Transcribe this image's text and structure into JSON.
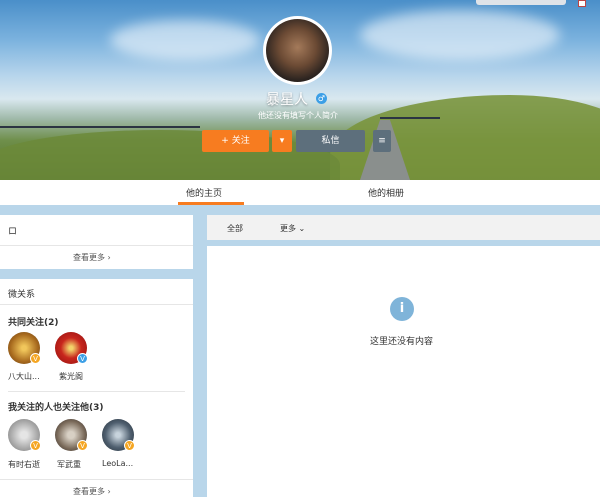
{
  "profile": {
    "name": "暴星人",
    "gender_icon": "male-icon",
    "bio": "他还没有填写个人简介"
  },
  "actions": {
    "follow_label": "+ 关注",
    "message_label": "私信"
  },
  "tabs": [
    {
      "label": "他的主页",
      "active": true
    },
    {
      "label": "他的相册",
      "active": false
    }
  ],
  "left": {
    "box1_title": "ロ",
    "box1_more": "查看更多 ›",
    "relations_title": "微关系",
    "mutual_title": "共同关注(2)",
    "mutual_users": [
      {
        "name": "八大山...",
        "badge": "V",
        "badge_color": "#f5a623"
      },
      {
        "name": "紫光阁",
        "badge": "V",
        "badge_color": "#3c9fe6"
      }
    ],
    "follow_title": "我关注的人也关注他(3)",
    "follow_users": [
      {
        "name": "有时右逝",
        "badge": "V",
        "badge_color": "#f5a623"
      },
      {
        "name": "军武重",
        "badge": "V",
        "badge_color": "#f5a623"
      },
      {
        "name": "LeoLa...",
        "badge": "V",
        "badge_color": "#f5a623"
      }
    ],
    "box2_more": "查看更多 ›"
  },
  "feed": {
    "filter_all": "全部",
    "filter_more": "更多 ⌄",
    "empty_text": "这里还没有内容",
    "empty_icon": "info-icon"
  },
  "colors": {
    "accent": "#f77c20",
    "secondary_button": "#5d6f7c",
    "page_bg": "#b9d6ea"
  }
}
